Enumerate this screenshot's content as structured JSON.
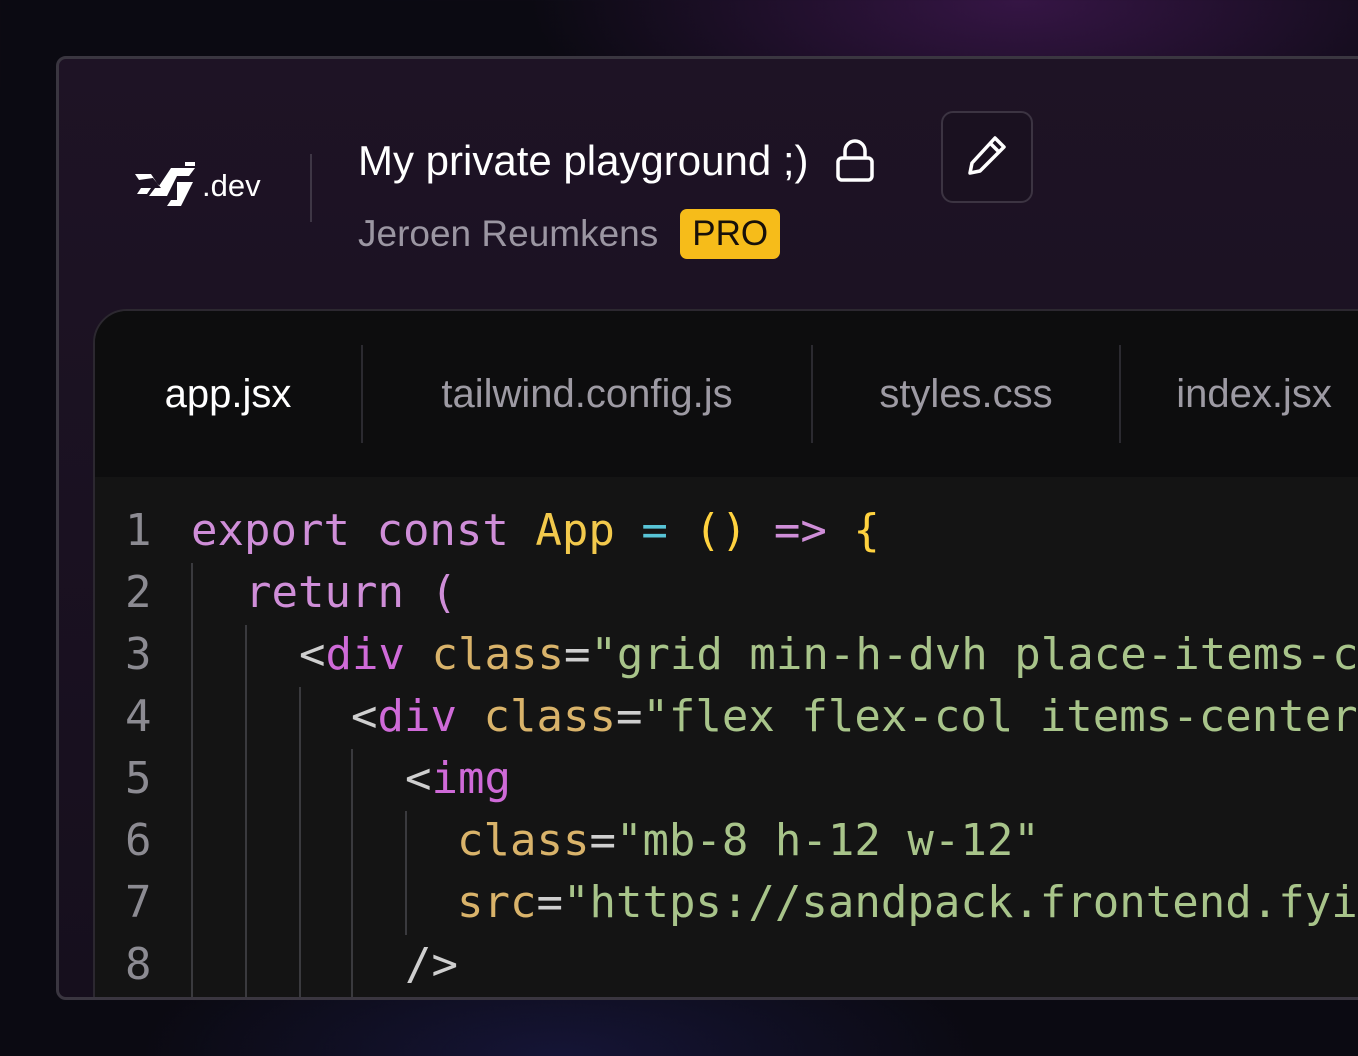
{
  "header": {
    "logo_suffix": ".dev",
    "title": "My private playground ;)",
    "author": "Jeroen Reumkens",
    "badge": "PRO",
    "icons": {
      "lock": "lock-icon",
      "edit": "pencil-icon",
      "logo": "logo-mark-icon"
    }
  },
  "tabs": [
    {
      "label": "app.jsx",
      "active": true
    },
    {
      "label": "tailwind.config.js",
      "active": false
    },
    {
      "label": "styles.css",
      "active": false
    },
    {
      "label": "index.jsx",
      "active": false
    }
  ],
  "colors": {
    "keyword": "#cf8ed8",
    "identifier": "#f2c94c",
    "operator": "#58c4d6",
    "punctuation": "#ffd23f",
    "tag": "#cf6ad8",
    "attribute": "#d9b36a",
    "string": "#a8c48a",
    "plain": "#cfcfcf",
    "badge": "#f6bc1a"
  },
  "code": {
    "lines": [
      {
        "num": "1",
        "tokens": [
          {
            "t": "export",
            "c": "keyword"
          },
          {
            "t": " ",
            "c": "plain"
          },
          {
            "t": "const",
            "c": "keyword"
          },
          {
            "t": " ",
            "c": "plain"
          },
          {
            "t": "App",
            "c": "identifier"
          },
          {
            "t": " ",
            "c": "plain"
          },
          {
            "t": "=",
            "c": "operator"
          },
          {
            "t": " ",
            "c": "plain"
          },
          {
            "t": "()",
            "c": "punctuation"
          },
          {
            "t": " ",
            "c": "plain"
          },
          {
            "t": "=>",
            "c": "keyword"
          },
          {
            "t": " ",
            "c": "plain"
          },
          {
            "t": "{",
            "c": "punctuation"
          }
        ]
      },
      {
        "num": "2",
        "tokens": [
          {
            "t": "return",
            "c": "keyword"
          },
          {
            "t": " ",
            "c": "plain"
          },
          {
            "t": "(",
            "c": "keyword"
          }
        ]
      },
      {
        "num": "3",
        "tokens": [
          {
            "t": "<",
            "c": "plain"
          },
          {
            "t": "div",
            "c": "tag"
          },
          {
            "t": " ",
            "c": "plain"
          },
          {
            "t": "class",
            "c": "attribute"
          },
          {
            "t": "=",
            "c": "plain"
          },
          {
            "t": "\"grid min-h-dvh place-items-c",
            "c": "string"
          }
        ]
      },
      {
        "num": "4",
        "tokens": [
          {
            "t": "<",
            "c": "plain"
          },
          {
            "t": "div",
            "c": "tag"
          },
          {
            "t": " ",
            "c": "plain"
          },
          {
            "t": "class",
            "c": "attribute"
          },
          {
            "t": "=",
            "c": "plain"
          },
          {
            "t": "\"flex flex-col items-center",
            "c": "string"
          }
        ]
      },
      {
        "num": "5",
        "tokens": [
          {
            "t": "<",
            "c": "plain"
          },
          {
            "t": "img",
            "c": "tag"
          }
        ]
      },
      {
        "num": "6",
        "tokens": [
          {
            "t": "class",
            "c": "attribute"
          },
          {
            "t": "=",
            "c": "plain"
          },
          {
            "t": "\"mb-8 h-12 w-12\"",
            "c": "string"
          }
        ]
      },
      {
        "num": "7",
        "tokens": [
          {
            "t": "src",
            "c": "attribute"
          },
          {
            "t": "=",
            "c": "plain"
          },
          {
            "t": "\"https://sandpack.frontend.fyi",
            "c": "string"
          }
        ]
      },
      {
        "num": "8",
        "tokens": [
          {
            "t": "/>",
            "c": "plain"
          }
        ]
      }
    ]
  }
}
